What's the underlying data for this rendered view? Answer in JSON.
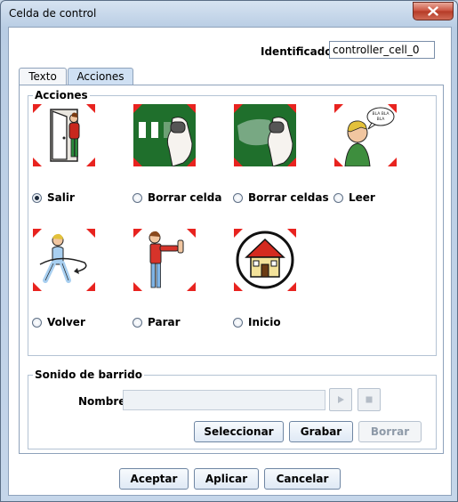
{
  "window": {
    "title": "Celda de control"
  },
  "identifier": {
    "label": "Identificador",
    "value": "controller_cell_0"
  },
  "tabs": [
    {
      "label": "Texto"
    },
    {
      "label": "Acciones"
    }
  ],
  "acciones": {
    "group_label": "Acciones",
    "selected": "Salir",
    "options": [
      {
        "label": "Salir",
        "icon": "exit-door-picto-icon"
      },
      {
        "label": "Borrar celda",
        "icon": "erase-cell-picto-icon"
      },
      {
        "label": "Borrar celdas",
        "icon": "erase-cells-picto-icon"
      },
      {
        "label": "Leer",
        "icon": "read-speak-picto-icon",
        "speech_text": "BLA BLA BLA"
      },
      {
        "label": "Volver",
        "icon": "go-back-picto-icon"
      },
      {
        "label": "Parar",
        "icon": "stop-picto-icon"
      },
      {
        "label": "Inicio",
        "icon": "home-picto-icon"
      }
    ]
  },
  "sonido": {
    "group_label": "Sonido de barrido",
    "nombre_label": "Nombre",
    "nombre_value": "",
    "buttons": {
      "select": "Seleccionar",
      "record": "Grabar",
      "delete": "Borrar"
    }
  },
  "footer": {
    "accept": "Aceptar",
    "apply": "Aplicar",
    "cancel": "Cancelar"
  },
  "colors": {
    "corner_marker": "#e8231f",
    "picto_green": "#1f6f2c",
    "selected_tab": "#cfe0f3"
  }
}
